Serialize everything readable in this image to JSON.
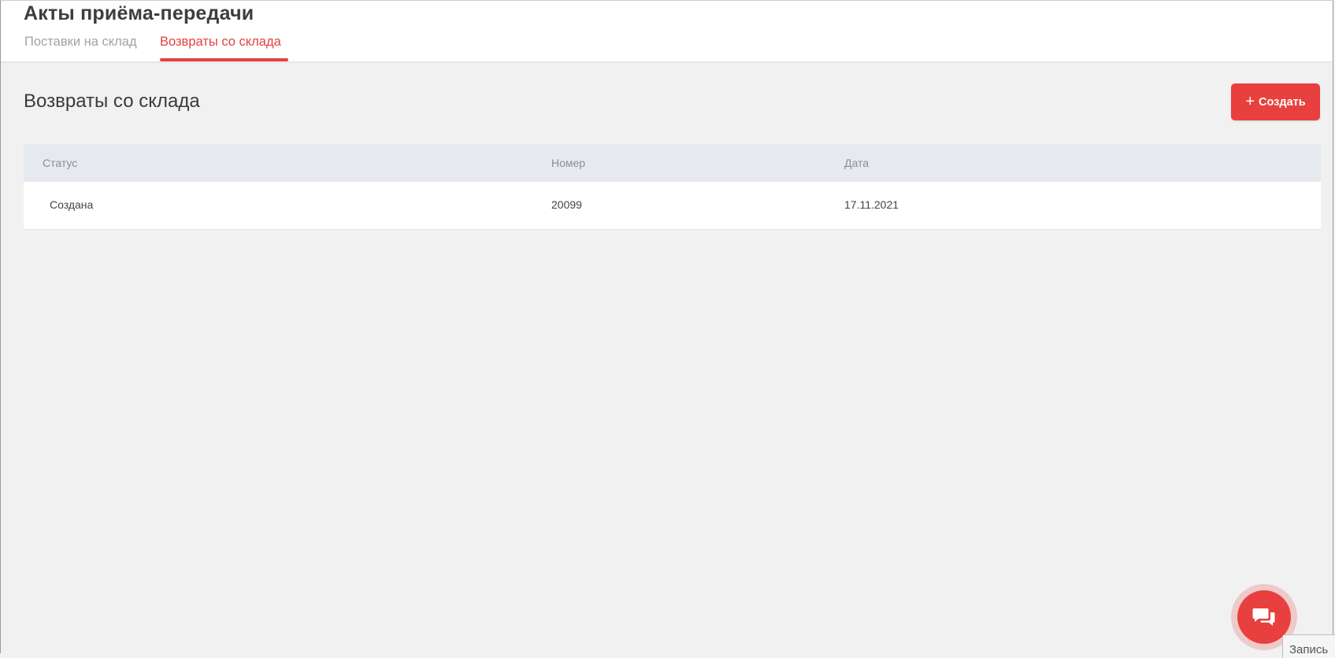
{
  "header": {
    "title": "Акты приёма-передачи",
    "tabs": [
      {
        "label": "Поставки на склад",
        "active": false
      },
      {
        "label": "Возвраты со склада",
        "active": true
      }
    ]
  },
  "main": {
    "section_title": "Возвраты со склада",
    "create_button": {
      "icon": "plus-icon",
      "label": "Создать"
    },
    "table": {
      "columns": [
        "Статус",
        "Номер",
        "Дата"
      ],
      "rows": [
        {
          "status": "Создана",
          "number": "20099",
          "date": "17.11.2021"
        }
      ]
    }
  },
  "chat_widget": {
    "icon": "chat-bubbles-icon"
  },
  "record_tab": {
    "label": "Запись"
  },
  "colors": {
    "accent": "#e8403e",
    "background": "#f1f1f1",
    "table_header": "#e6e9ef"
  }
}
